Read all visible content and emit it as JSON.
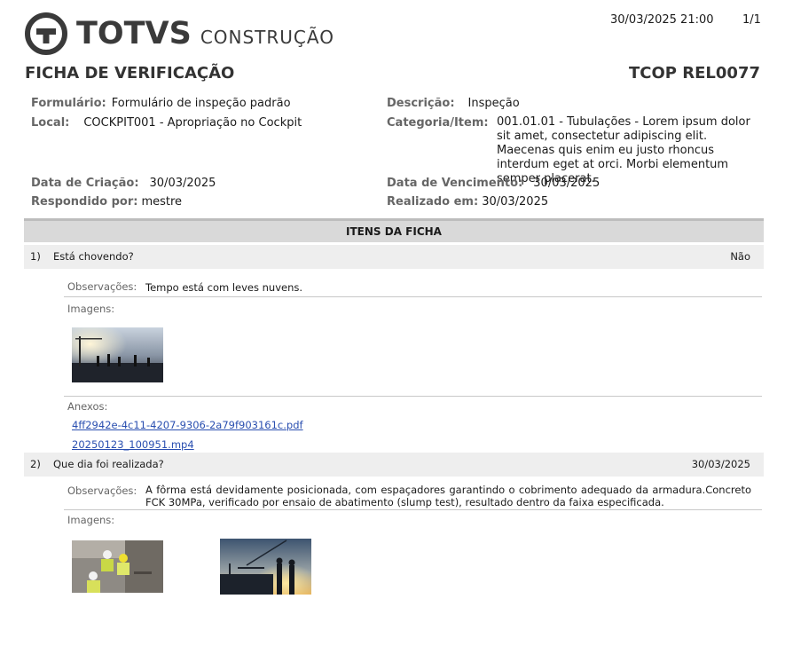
{
  "header": {
    "logo_word": "TOTVS",
    "logo_sub": "CONSTRUÇÃO",
    "datetime": "30/03/2025 21:00",
    "page": "1/1",
    "title": "FICHA DE VERIFICAÇÃO",
    "code": "TCOP REL0077"
  },
  "info": {
    "formulario_label": "Formulário:",
    "formulario_value": "Formulário de inspeção padrão",
    "local_label": "Local:",
    "local_value": "COCKPIT001 - Apropriação no Cockpit",
    "data_criacao_label": "Data de Criação:",
    "data_criacao_value": "30/03/2025",
    "respondido_label": "Respondido por:",
    "respondido_value": "mestre",
    "descricao_label": "Descrição:",
    "descricao_value": "Inspeção",
    "categoria_label": "Categoria/Item:",
    "categoria_value": "001.01.01 - Tubulações - Lorem ipsum dolor sit amet, consectetur adipiscing elit. Maecenas quis enim eu justo rhoncus interdum eget at orci. Morbi elementum semper placerat.",
    "vencimento_label": "Data de Vencimento:",
    "vencimento_value": "30/03/2025",
    "realizado_label": "Realizado em:",
    "realizado_value": "30/03/2025"
  },
  "section_title": "ITENS DA FICHA",
  "items": [
    {
      "number": "1)",
      "question": "Está chovendo?",
      "answer": "Não",
      "obs_label": "Observações:",
      "obs_value": "Tempo está com leves nuvens.",
      "images_label": "Imagens:",
      "attachments_label": "Anexos:",
      "attachments": [
        "4ff2942e-4c11-4207-9306-2a79f903161c.pdf",
        "20250123_100951.mp4"
      ]
    },
    {
      "number": "2)",
      "question": "Que dia foi realizada?",
      "answer": "30/03/2025",
      "obs_label": "Observações:",
      "obs_value": "A fôrma está devidamente posicionada, com espaçadores garantindo o cobrimento adequado da armadura.Concreto FCK 30MPa, verificado por ensaio de abatimento (slump test), resultado dentro da faixa especificada.",
      "images_label": "Imagens:"
    }
  ],
  "colors": {
    "section_bg": "#d9d9d9",
    "row_bg": "#eeeeee",
    "label_gray": "#666666",
    "link_blue": "#2a4fb0"
  }
}
